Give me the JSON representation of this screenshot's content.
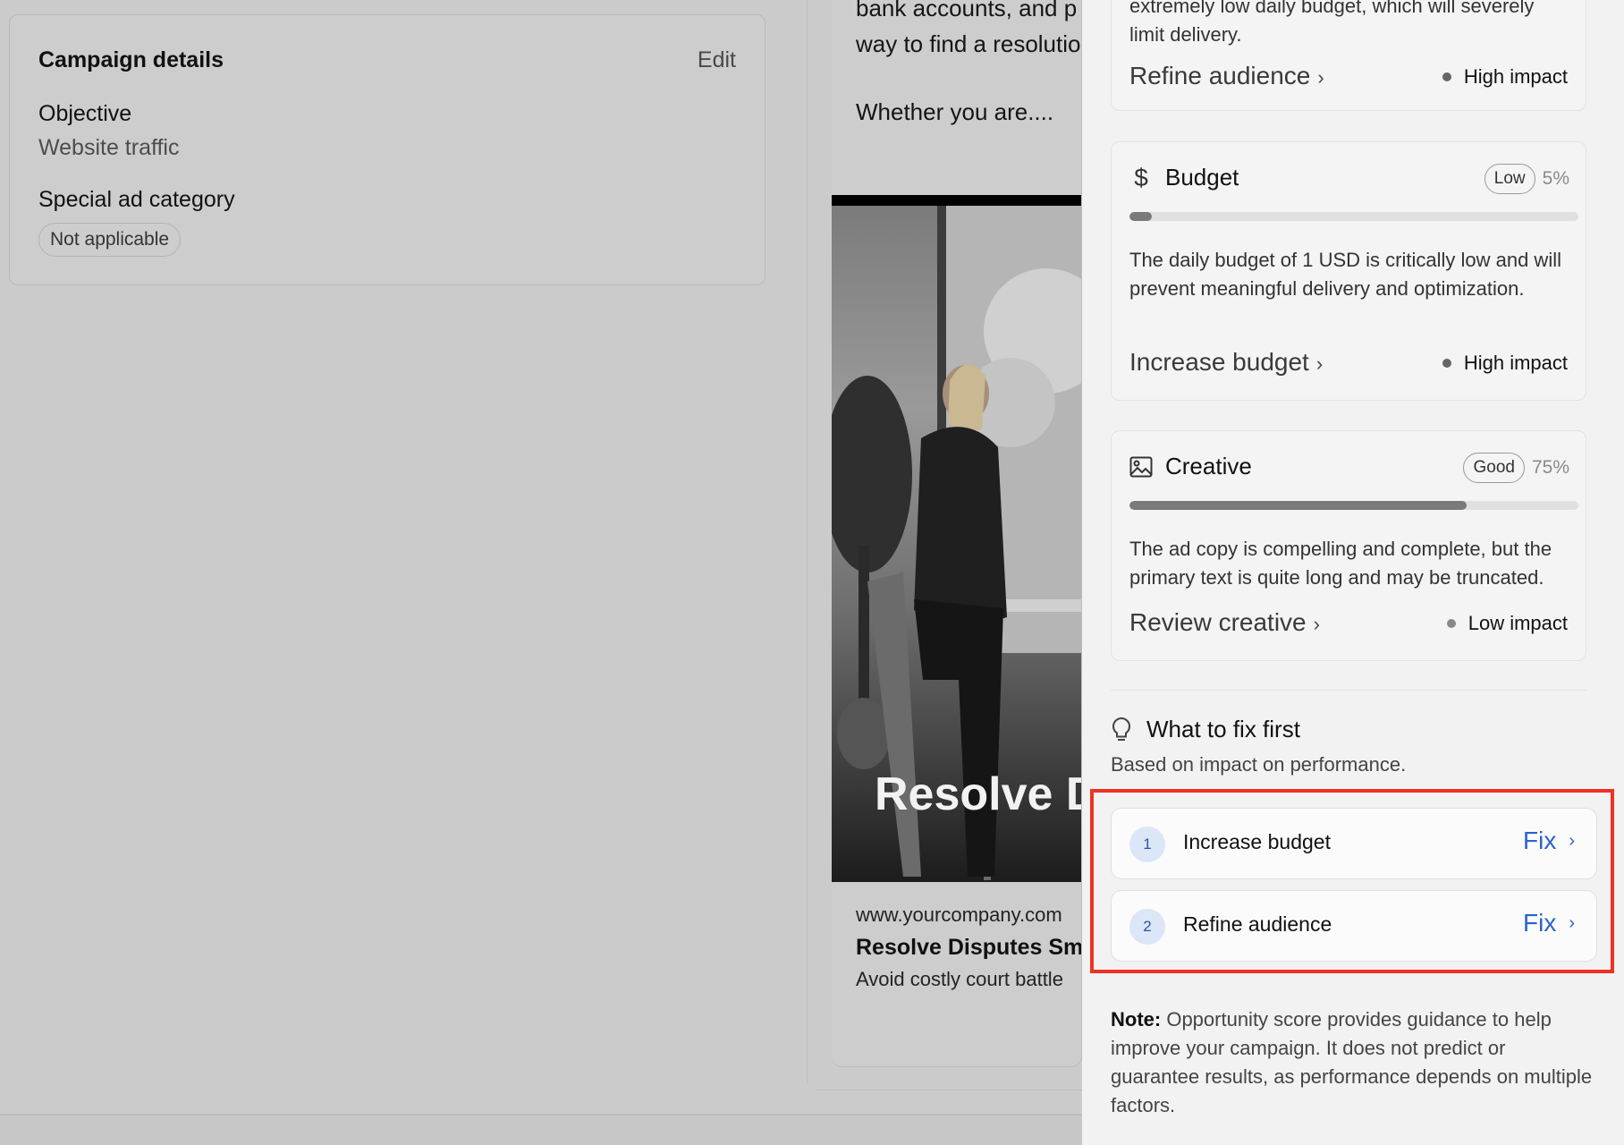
{
  "campaign_details": {
    "title": "Campaign details",
    "edit_label": "Edit",
    "objective_label": "Objective",
    "objective_value": "Website traffic",
    "special_category_label": "Special ad category",
    "special_category_value": "Not applicable"
  },
  "ad_preview": {
    "body_line_1": "bank accounts, and p",
    "body_line_2": "way to find a resolutio",
    "body_line_3": "Whether you are....",
    "image_headline": "Resolve D",
    "url": "www.yourcompany.com",
    "headline": "Resolve Disputes Sma",
    "description": "Avoid costly court battle"
  },
  "panel": {
    "audience_card": {
      "text_1": "extremely low daily budget, which will severely",
      "text_2": "limit delivery.",
      "action": "Refine audience",
      "impact": "High impact"
    },
    "budget_card": {
      "name": "Budget",
      "icon": "dollar-icon",
      "rating": "Low",
      "percent_text": "5%",
      "score_fraction": 0.05,
      "description": "The daily budget of 1 USD is critically low and will prevent meaningful delivery and optimization.",
      "action": "Increase budget",
      "impact": "High impact"
    },
    "creative_card": {
      "name": "Creative",
      "icon": "image-icon",
      "rating": "Good",
      "percent_text": "75%",
      "score_fraction": 0.75,
      "description": "The ad copy is compelling and complete, but the primary text is quite long and may be truncated.",
      "action": "Review creative",
      "impact": "Low impact"
    },
    "fix_first": {
      "title": "What to fix first",
      "subtitle": "Based on impact on performance.",
      "items": [
        {
          "number": "1",
          "label": "Increase budget",
          "button": "Fix"
        },
        {
          "number": "2",
          "label": "Refine audience",
          "button": "Fix"
        }
      ]
    },
    "note": {
      "label": "Note:",
      "text": " Opportunity score provides guidance to help improve your campaign. It does not predict or guarantee results, as performance depends on multiple factors."
    }
  },
  "colors": {
    "accent_blue": "#2c63c9",
    "highlight_red": "#ee3224"
  }
}
